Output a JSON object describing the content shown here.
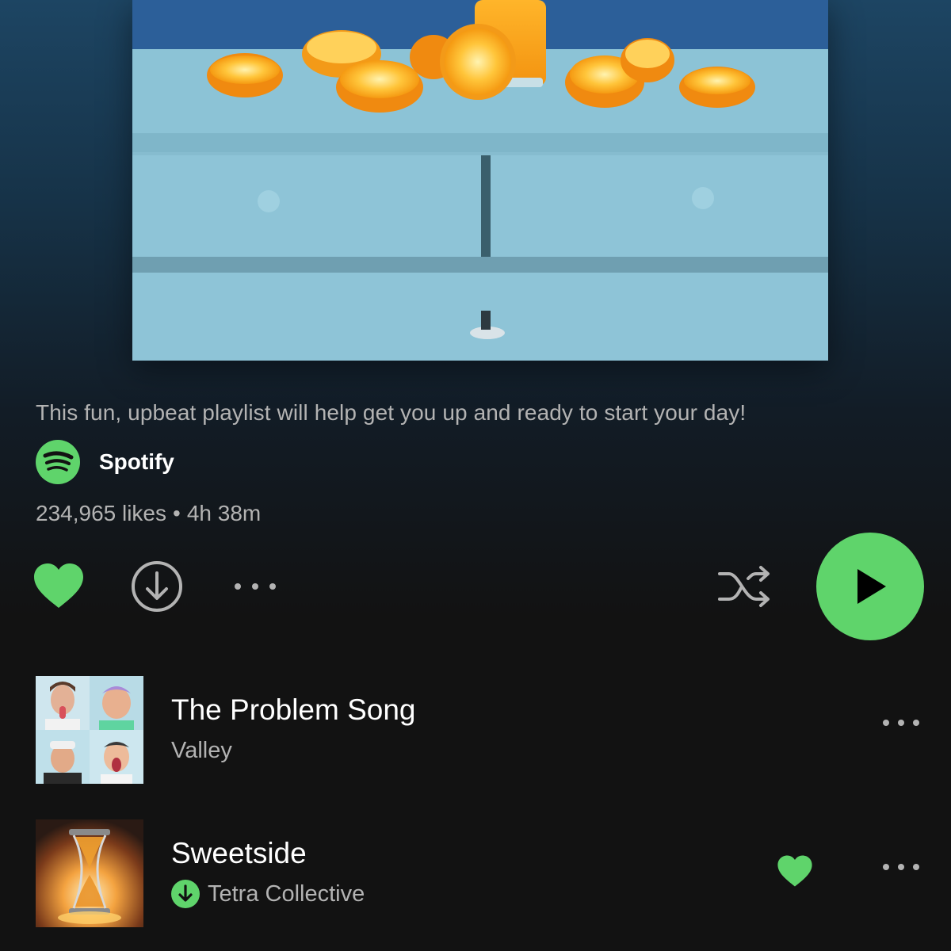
{
  "playlist": {
    "description": "This fun, upbeat playlist will help get you up and ready to start your day!",
    "owner": "Spotify",
    "likes": "234,965 likes",
    "separator": "•",
    "duration": "4h 38m"
  },
  "colors": {
    "accent": "#5fd46b",
    "secondary_text": "#b3b3b3",
    "background": "#121212"
  },
  "actions": {
    "like_icon": "heart-filled-icon",
    "download_icon": "download-icon",
    "more_icon": "more-horizontal-icon",
    "shuffle_icon": "shuffle-icon",
    "play_icon": "play-icon",
    "liked": true
  },
  "tracks": [
    {
      "title": "The Problem Song",
      "artist": "Valley",
      "downloaded": false,
      "liked": false
    },
    {
      "title": "Sweetside",
      "artist": "Tetra Collective",
      "downloaded": true,
      "liked": true
    }
  ]
}
